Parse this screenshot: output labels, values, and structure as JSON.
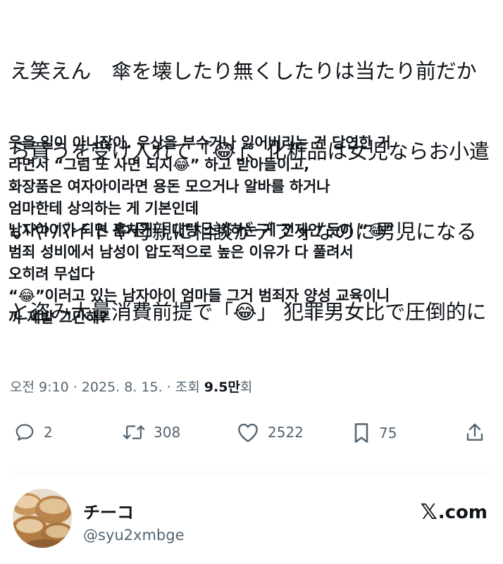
{
  "tweet": {
    "text_jp_lines": [
      "え笑えん　傘を壊したり無くしたりは当たり前だか",
      "ら買うを受け入れて「😂」、化粧品は女児ならお小遣",
      "いやバイトや母親に相談がデフォなのに男児になる",
      "と盗み大量消費前提で「😂」 犯罪男女比で圧倒的に"
    ],
    "text_ko_lines": [
      "웃을 일이 아니잖아. 우산을 부수거나 잃어버리는 건 당연한 거",
      "라면서 “그럼 또 사면 되지😂” 하고 받아들이고,",
      "화장품은 여자아이라면 용돈 모으거나 알바를 하거나",
      "엄마한테 상의하는 게 기본인데",
      "남자아이가 되면 훔치거나 대량 소비하는 게 전제인 듯이 “😂”",
      "범죄 성비에서 남성이 압도적으로 높은 이유가 다 풀려서",
      "오히려 무섭다",
      "“😂”이러고 있는 남자아이 엄마들 그거 범죄자 양성 교육이니",
      "까 제발 그만해?"
    ],
    "meta": {
      "time": "오전 9:10",
      "sep1": " · ",
      "date": "2025. 8. 15.",
      "sep2": " · ",
      "views_label_pre": "조회 ",
      "views_value": "9.5만",
      "views_label_post": "회"
    },
    "actions": {
      "reply_count": "2",
      "retweet_count": "308",
      "like_count": "2522",
      "bookmark_count": "75"
    }
  },
  "author": {
    "name": "チーコ",
    "handle": "@syu2xmbge"
  },
  "brand": {
    "x_glyph": "𝕏",
    "suffix": ".com"
  },
  "colors": {
    "text": "#0f1419",
    "secondary": "#536471",
    "divider": "#eff3f4"
  },
  "icons": {
    "reply": "reply-icon",
    "retweet": "retweet-icon",
    "like": "heart-icon",
    "bookmark": "bookmark-icon",
    "share": "share-icon"
  }
}
